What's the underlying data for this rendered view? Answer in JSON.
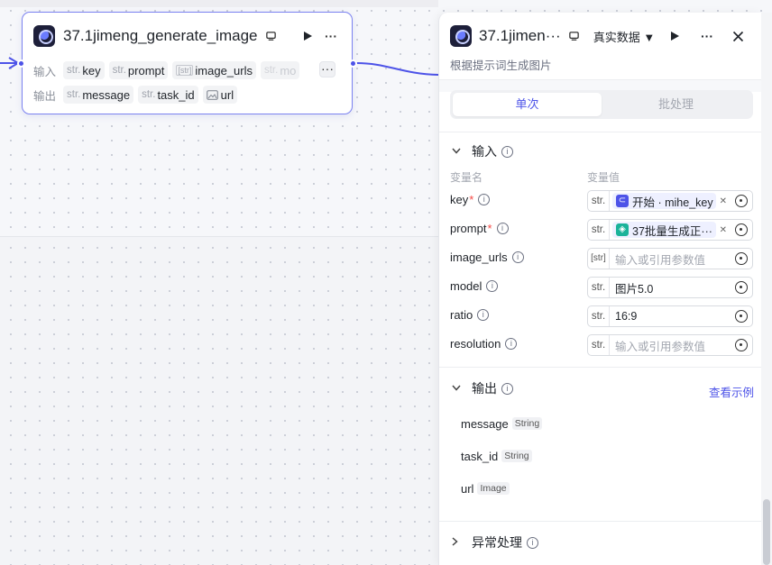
{
  "node": {
    "title": "37.1jimeng_generate_image",
    "input_label": "输入",
    "output_label": "输出",
    "type_str": "str.",
    "type_arr": "[str]",
    "inputs": [
      "key",
      "prompt",
      "image_urls",
      "mo"
    ],
    "outputs": [
      "message",
      "task_id",
      "url"
    ],
    "more": "···"
  },
  "panel": {
    "title": "37.1jimen···",
    "data_mode": "真实数据 ▼",
    "description": "根据提示词生成图片",
    "tabs": [
      "单次",
      "批处理"
    ],
    "input_section": "输入",
    "col_name": "变量名",
    "col_value": "变量值",
    "variables": [
      {
        "name": "key",
        "required": true,
        "type": "str.",
        "ref_label": "开始 · mihe_key"
      },
      {
        "name": "prompt",
        "required": true,
        "type": "str.",
        "ref_label": "37批量生成正···"
      },
      {
        "name": "image_urls",
        "required": false,
        "type": "[str]",
        "placeholder": "输入或引用参数值"
      },
      {
        "name": "model",
        "required": false,
        "type": "str.",
        "value": "图片5.0"
      },
      {
        "name": "ratio",
        "required": false,
        "type": "str.",
        "value": "16:9"
      },
      {
        "name": "resolution",
        "required": false,
        "type": "str.",
        "placeholder": "输入或引用参数值"
      }
    ],
    "output_section": "输出",
    "view_example": "查看示例",
    "outputs": [
      {
        "name": "message",
        "type": "String"
      },
      {
        "name": "task_id",
        "type": "String"
      },
      {
        "name": "url",
        "type": "Image"
      }
    ],
    "exception_section": "异常处理"
  },
  "colors": {
    "accent": "#4d53e8",
    "node_border": "#7b82f0",
    "required": "#f54a45",
    "ref_start": "#4d53e8",
    "ref_batch": "#1bb39a"
  }
}
